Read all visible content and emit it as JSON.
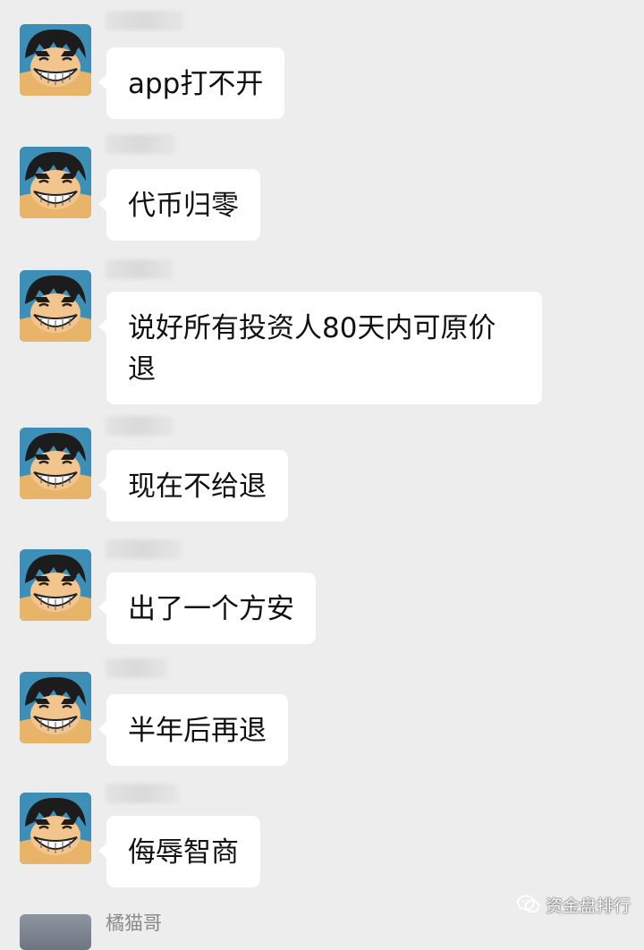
{
  "messages": [
    {
      "text": "app打不开"
    },
    {
      "text": "代币归零"
    },
    {
      "text": "说好所有投资人80天内可原价退"
    },
    {
      "text": "现在不给退"
    },
    {
      "text": "出了一个方安"
    },
    {
      "text": "半年后再退"
    },
    {
      "text": "侮辱智商"
    }
  ],
  "last_sender_name": "橘猫哥",
  "watermark": {
    "text": "资金盘排行",
    "icon": "wechat-icon"
  },
  "colors": {
    "background": "#ededed",
    "bubble": "#ffffff",
    "text": "#111111"
  }
}
